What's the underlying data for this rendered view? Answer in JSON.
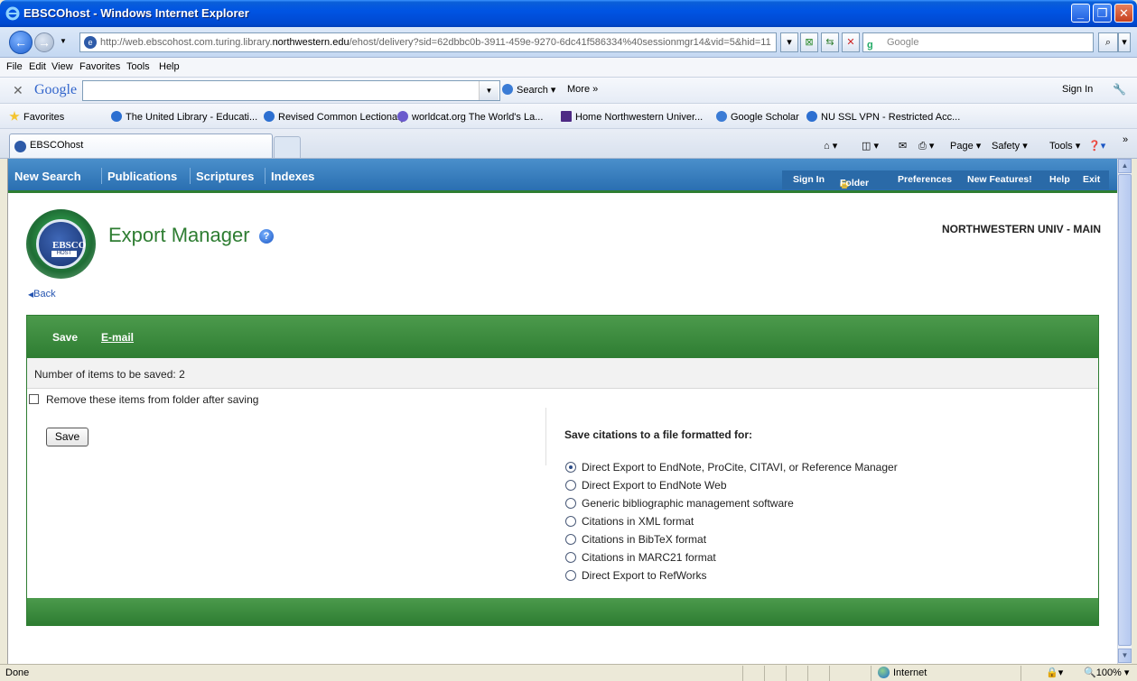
{
  "window": {
    "title": "EBSCOhost - Windows Internet Explorer"
  },
  "address": {
    "url_prefix": "http://web.ebscohost.com.turing.library.",
    "url_host": "northwestern.edu",
    "url_suffix": "/ehost/delivery?sid=62dbbc0b-3911-459e-9270-6dc41f586334%40sessionmgr14&vid=5&hid=11",
    "search_placeholder": "Google"
  },
  "menu": [
    "File",
    "Edit",
    "View",
    "Favorites",
    "Tools",
    "Help"
  ],
  "google_toolbar": {
    "logo": "Google",
    "search_label": "Search",
    "more_label": "More",
    "sign_in": "Sign In"
  },
  "favorites": {
    "label": "Favorites",
    "items": [
      "The United Library - Educati...",
      "Revised Common Lectionary",
      "worldcat.org The World's La...",
      "Home  Northwestern Univer...",
      "Google Scholar",
      "NU SSL VPN - Restricted Acc..."
    ]
  },
  "tab": {
    "label": "EBSCOhost"
  },
  "command_bar": {
    "page": "Page",
    "safety": "Safety",
    "tools": "Tools"
  },
  "ebsco_nav": {
    "left": [
      "New Search",
      "Publications",
      "Scriptures",
      "Indexes"
    ],
    "right": [
      "Sign In",
      "Folder",
      "Preferences",
      "New Features!",
      "Help",
      "Exit"
    ]
  },
  "header": {
    "logo_text": "EBSCO",
    "logo_subtext": "HOST",
    "title": "Export Manager",
    "institution": "NORTHWESTERN UNIV - MAIN",
    "back": "Back"
  },
  "export": {
    "tabs": [
      "Save",
      "E-mail"
    ],
    "count_text": "Number of items to be saved: 2",
    "remove_checkbox_label": "Remove these items from folder after saving",
    "remove_checked": false,
    "save_button": "Save",
    "format_heading": "Save citations to a file formatted for:",
    "formats": [
      {
        "label": "Direct Export to EndNote, ProCite, CITAVI, or Reference Manager",
        "selected": true
      },
      {
        "label": "Direct Export to EndNote Web",
        "selected": false
      },
      {
        "label": "Generic bibliographic management software",
        "selected": false
      },
      {
        "label": "Citations in XML format",
        "selected": false
      },
      {
        "label": "Citations in BibTeX format",
        "selected": false
      },
      {
        "label": "Citations in MARC21 format",
        "selected": false
      },
      {
        "label": "Direct Export to RefWorks",
        "selected": false
      }
    ]
  },
  "status": {
    "text": "Done",
    "zone": "Internet",
    "zoom": "100%"
  },
  "colors": {
    "ebsco_green": "#2e7d32",
    "ebsco_blue": "#2a6fb1",
    "xp_title_blue": "#0054e3"
  }
}
